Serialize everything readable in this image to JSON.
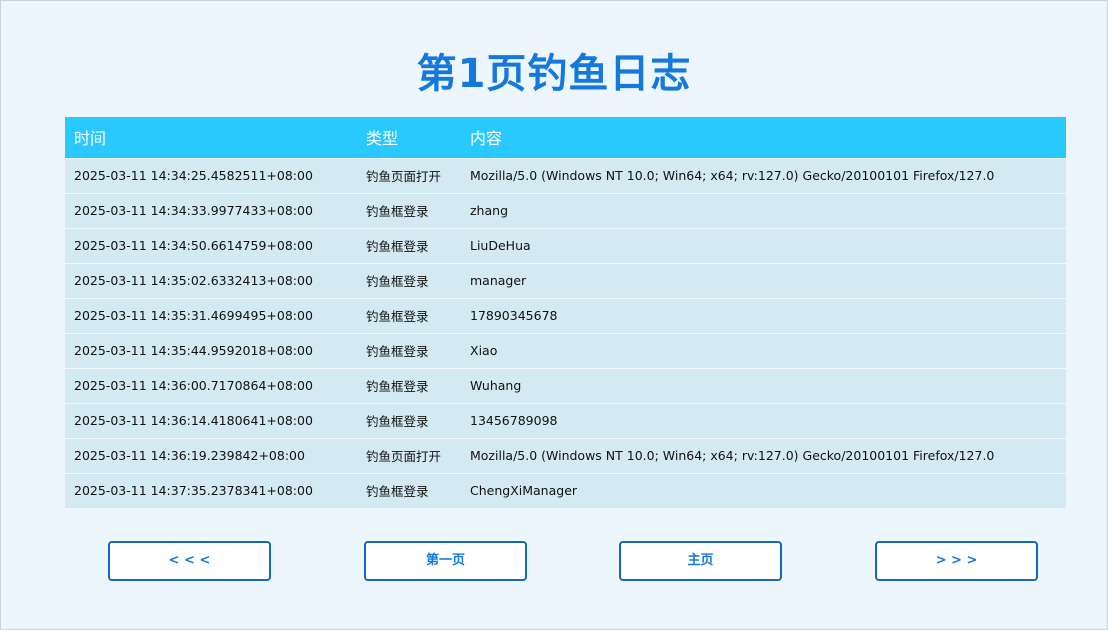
{
  "title": "第1页钓鱼日志",
  "table": {
    "headers": {
      "time": "时间",
      "type": "类型",
      "content": "内容"
    },
    "rows": [
      {
        "time": "2025-03-11 14:34:25.4582511+08:00",
        "type": "钓鱼页面打开",
        "content": "Mozilla/5.0 (Windows NT 10.0; Win64; x64; rv:127.0) Gecko/20100101 Firefox/127.0"
      },
      {
        "time": "2025-03-11 14:34:33.9977433+08:00",
        "type": "钓鱼框登录",
        "content": "zhang"
      },
      {
        "time": "2025-03-11 14:34:50.6614759+08:00",
        "type": "钓鱼框登录",
        "content": "LiuDeHua"
      },
      {
        "time": "2025-03-11 14:35:02.6332413+08:00",
        "type": "钓鱼框登录",
        "content": "manager"
      },
      {
        "time": "2025-03-11 14:35:31.4699495+08:00",
        "type": "钓鱼框登录",
        "content": "17890345678"
      },
      {
        "time": "2025-03-11 14:35:44.9592018+08:00",
        "type": "钓鱼框登录",
        "content": "Xiao"
      },
      {
        "time": "2025-03-11 14:36:00.7170864+08:00",
        "type": "钓鱼框登录",
        "content": "Wuhang"
      },
      {
        "time": "2025-03-11 14:36:14.4180641+08:00",
        "type": "钓鱼框登录",
        "content": "13456789098"
      },
      {
        "time": "2025-03-11 14:36:19.239842+08:00",
        "type": "钓鱼页面打开",
        "content": "Mozilla/5.0 (Windows NT 10.0; Win64; x64; rv:127.0) Gecko/20100101 Firefox/127.0"
      },
      {
        "time": "2025-03-11 14:37:35.2378341+08:00",
        "type": "钓鱼框登录",
        "content": "ChengXiManager"
      }
    ]
  },
  "nav": {
    "prev": "< < <",
    "first": "第一页",
    "home": "主页",
    "next": "> > >"
  },
  "colors": {
    "title": "#1478dc",
    "header_bg": "#29c8fd",
    "row_bg": "#d3eaf3",
    "page_bg": "#eef6fd",
    "button_border": "#1669b8"
  }
}
